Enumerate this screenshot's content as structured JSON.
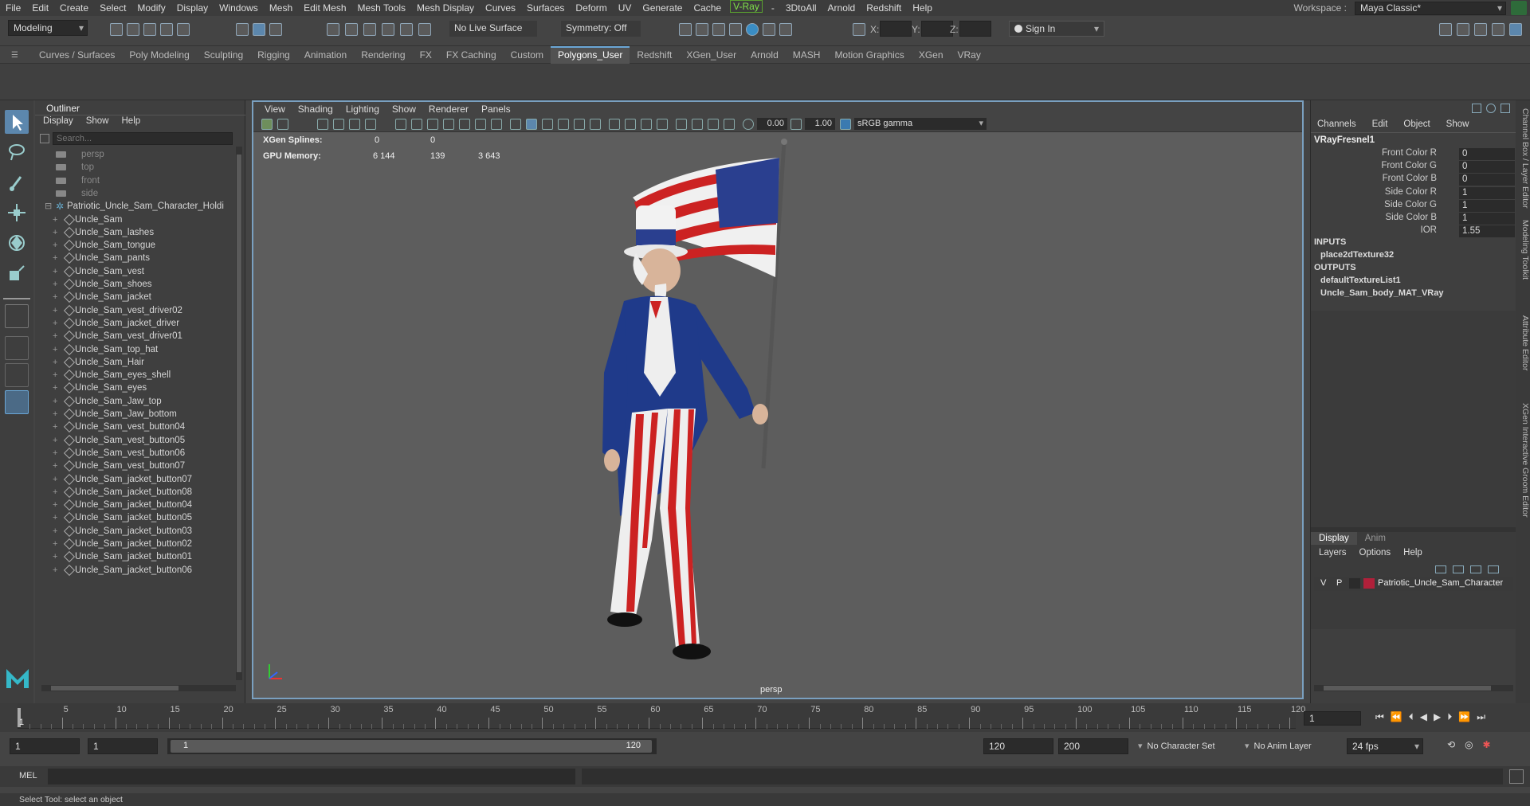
{
  "menubar": {
    "items": [
      "File",
      "Edit",
      "Create",
      "Select",
      "Modify",
      "Display",
      "Windows",
      "Mesh",
      "Edit Mesh",
      "Mesh Tools",
      "Mesh Display",
      "Curves",
      "Surfaces",
      "Deform",
      "UV",
      "Generate",
      "Cache"
    ],
    "vray": "V-Ray",
    "items2": [
      "3DtoAll",
      "Arnold",
      "Redshift",
      "Help"
    ],
    "vray_sep": "-",
    "workspace_label": "Workspace :",
    "workspace_value": "Maya Classic*"
  },
  "statusline": {
    "mode": "Modeling",
    "live_surface": "No Live Surface",
    "symmetry": "Symmetry: Off",
    "sign_in": "Sign In",
    "x_label": "X:",
    "y_label": "Y:",
    "z_label": "Z:"
  },
  "shelf": {
    "tabs": [
      "Curves / Surfaces",
      "Poly Modeling",
      "Sculpting",
      "Rigging",
      "Animation",
      "Rendering",
      "FX",
      "FX Caching",
      "Custom",
      "Polygons_User",
      "Redshift",
      "XGen_User",
      "Arnold",
      "MASH",
      "Motion Graphics",
      "XGen",
      "VRay"
    ],
    "active_tab": "Polygons_User"
  },
  "outliner": {
    "title": "Outliner",
    "menu": [
      "Display",
      "Show",
      "Help"
    ],
    "search_placeholder": "Search...",
    "cameras": [
      "persp",
      "top",
      "front",
      "side"
    ],
    "root": "Patriotic_Uncle_Sam_Character_Holdi",
    "items": [
      "Uncle_Sam",
      "Uncle_Sam_lashes",
      "Uncle_Sam_tongue",
      "Uncle_Sam_pants",
      "Uncle_Sam_vest",
      "Uncle_Sam_shoes",
      "Uncle_Sam_jacket",
      "Uncle_Sam_vest_driver02",
      "Uncle_Sam_jacket_driver",
      "Uncle_Sam_vest_driver01",
      "Uncle_Sam_top_hat",
      "Uncle_Sam_Hair",
      "Uncle_Sam_eyes_shell",
      "Uncle_Sam_eyes",
      "Uncle_Sam_Jaw_top",
      "Uncle_Sam_Jaw_bottom",
      "Uncle_Sam_vest_button04",
      "Uncle_Sam_vest_button05",
      "Uncle_Sam_vest_button06",
      "Uncle_Sam_vest_button07",
      "Uncle_Sam_jacket_button07",
      "Uncle_Sam_jacket_button08",
      "Uncle_Sam_jacket_button04",
      "Uncle_Sam_jacket_button05",
      "Uncle_Sam_jacket_button03",
      "Uncle_Sam_jacket_button02",
      "Uncle_Sam_jacket_button01",
      "Uncle_Sam_jacket_button06"
    ]
  },
  "viewport": {
    "menu": [
      "View",
      "Shading",
      "Lighting",
      "Show",
      "Renderer",
      "Panels"
    ],
    "field_a": "0.00",
    "field_b": "1.00",
    "colorspace": "sRGB gamma",
    "hud": {
      "xgen_label": "XGen Splines:",
      "xgen_values": [
        "0",
        "0"
      ],
      "gpu_label": "GPU Memory:",
      "gpu_values": [
        "6 144",
        "139",
        "3 643"
      ]
    },
    "camera_label": "persp"
  },
  "channelbox": {
    "menu": [
      "Channels",
      "Edit",
      "Object",
      "Show"
    ],
    "node": "VRayFresnel1",
    "attrs": [
      {
        "label": "Front Color R",
        "value": "0"
      },
      {
        "label": "Front Color G",
        "value": "0"
      },
      {
        "label": "Front Color B",
        "value": "0"
      },
      {
        "label": "Side Color R",
        "value": "1"
      },
      {
        "label": "Side Color G",
        "value": "1"
      },
      {
        "label": "Side Color B",
        "value": "1"
      },
      {
        "label": "IOR",
        "value": "1.55"
      }
    ],
    "inputs_label": "INPUTS",
    "inputs": [
      "place2dTexture32"
    ],
    "outputs_label": "OUTPUTS",
    "outputs": [
      "defaultTextureList1",
      "Uncle_Sam_body_MAT_VRay"
    ]
  },
  "layers": {
    "tabs": [
      "Display",
      "Anim"
    ],
    "menu": [
      "Layers",
      "Options",
      "Help"
    ],
    "row": {
      "v": "V",
      "p": "P",
      "name": "Patriotic_Uncle_Sam_Character"
    }
  },
  "vertical_tabs": [
    "Channel Box / Layer Editor",
    "Modeling Toolkit",
    "Attribute Editor",
    "XGen Interactive Groom Editor"
  ],
  "timeline": {
    "ticks": [
      "5",
      "10",
      "15",
      "20",
      "25",
      "30",
      "35",
      "40",
      "45",
      "50",
      "55",
      "60",
      "65",
      "70",
      "75",
      "80",
      "85",
      "90",
      "95",
      "100",
      "105",
      "110",
      "115",
      "120"
    ],
    "start_tick": "1",
    "current_frame": "1"
  },
  "range": {
    "start": "1",
    "playback_start": "1",
    "slider_start": "1",
    "slider_end": "120",
    "playback_end": "120",
    "end": "200",
    "character_set": "No Character Set",
    "anim_layer": "No Anim Layer",
    "fps": "24 fps"
  },
  "cmdline": {
    "label": "MEL"
  },
  "helpline": {
    "text": "Select Tool: select an object"
  }
}
